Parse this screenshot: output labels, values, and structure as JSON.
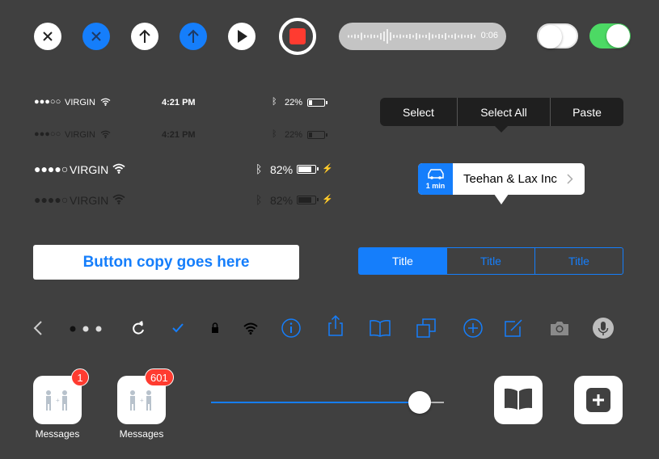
{
  "colors": {
    "background": "#404040",
    "accent": "#157efb",
    "toggle_on": "#4cd964",
    "record": "#ff3b30",
    "badge": "#ff3b30"
  },
  "top_controls": {
    "icons": [
      "close-icon",
      "close-icon",
      "arrow-up-icon",
      "arrow-up-icon",
      "play-icon",
      "record-icon"
    ],
    "audio_time": "0:06",
    "toggle_off": false,
    "toggle_on": true
  },
  "status_bars": [
    {
      "signal": "●●●○○",
      "carrier": "VIRGIN",
      "time": "4:21 PM",
      "battery_text": "22%",
      "battery_level": 0.22
    },
    {
      "signal": "●●●○○",
      "carrier": "VIRGIN",
      "time": "4:21 PM",
      "battery_text": "22%",
      "battery_level": 0.22
    },
    {
      "signal": "●●●●○",
      "carrier": "VIRGIN",
      "time": "",
      "battery_text": "82%",
      "battery_level": 0.82
    },
    {
      "signal": "●●●●○",
      "carrier": "VIRGIN",
      "time": "",
      "battery_text": "82%",
      "battery_level": 0.82
    }
  ],
  "edit_menu": {
    "items": [
      "Select",
      "Select All",
      "Paste"
    ]
  },
  "map_callout": {
    "eta": "1 min",
    "title": "Teehan & Lax Inc"
  },
  "button": {
    "label": "Button copy goes here"
  },
  "segmented": {
    "items": [
      "Title",
      "Title",
      "Title"
    ],
    "selected_index": 0
  },
  "toolbar_icons": [
    "back-chevron-icon",
    "page-dots-icon",
    "refresh-icon",
    "checkmark-icon",
    "lock-icon",
    "wifi-icon",
    "info-icon",
    "share-icon",
    "bookmarks-icon",
    "copy-icon",
    "add-circle-icon",
    "compose-icon",
    "camera-icon",
    "microphone-icon"
  ],
  "apps": [
    {
      "label": "Messages",
      "badge": "1"
    },
    {
      "label": "Messages",
      "badge": "601"
    }
  ],
  "slider": {
    "value": 0.89
  },
  "action_icons": [
    "book-icon",
    "add-icon"
  ]
}
